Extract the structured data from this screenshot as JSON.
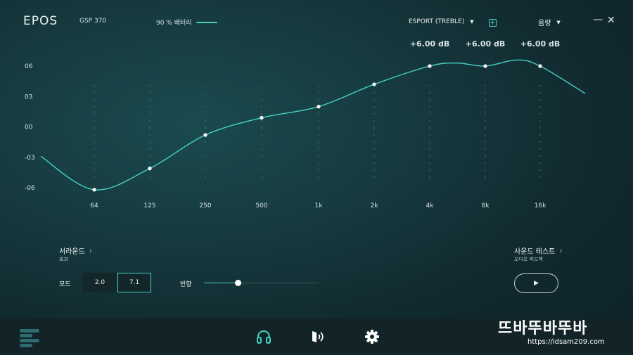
{
  "header": {
    "logo": "EPOS",
    "device": "GSP 370",
    "battery_text": "90 % 배터리",
    "battery_level": 0.9,
    "preset_label": "ESPORT (TREBLE)",
    "volume_label": "음량",
    "minimize_symbol": "—",
    "close_symbol": "✕"
  },
  "chart_data": {
    "type": "line",
    "title": "",
    "x": [
      "64",
      "125",
      "250",
      "500",
      "1k",
      "2k",
      "4k",
      "8k",
      "16k"
    ],
    "series": [
      {
        "values": [
          -6.2,
          -4.1,
          -0.8,
          0.9,
          2.0,
          4.2,
          6.0,
          6.0,
          6.0
        ]
      }
    ],
    "ylim": [
      -6,
      6
    ],
    "y_ticks": [
      "06",
      "03",
      "00",
      "-03",
      "-06"
    ],
    "annotations": [
      "+6.00 dB",
      "+6.00 dB",
      "+6.00 dB"
    ],
    "grid": "dotted-vertical",
    "line_color": "#46d3c5"
  },
  "surround": {
    "title": "서라운드",
    "subtitle": "효과",
    "help": "?",
    "mode_label": "모드",
    "mode_options": [
      "2.0",
      "7.1"
    ],
    "selected_mode": "7.1",
    "direction_label": "반향",
    "direction_value": 0.3
  },
  "sound_test": {
    "title": "사운드 테스트",
    "subtitle": "오디오 피드백",
    "help": "?",
    "play_symbol": "▶"
  },
  "bottom_nav": {
    "items": [
      "menu-icon",
      "headset-icon",
      "audio-icon",
      "settings-icon"
    ],
    "active": "headset-icon"
  },
  "watermark": {
    "title": "뜨바뚜바뚜바",
    "url": "https://idsam209.com"
  },
  "colors": {
    "accent": "#46d3c5",
    "background": "#163a3f",
    "bar": "#122428"
  }
}
